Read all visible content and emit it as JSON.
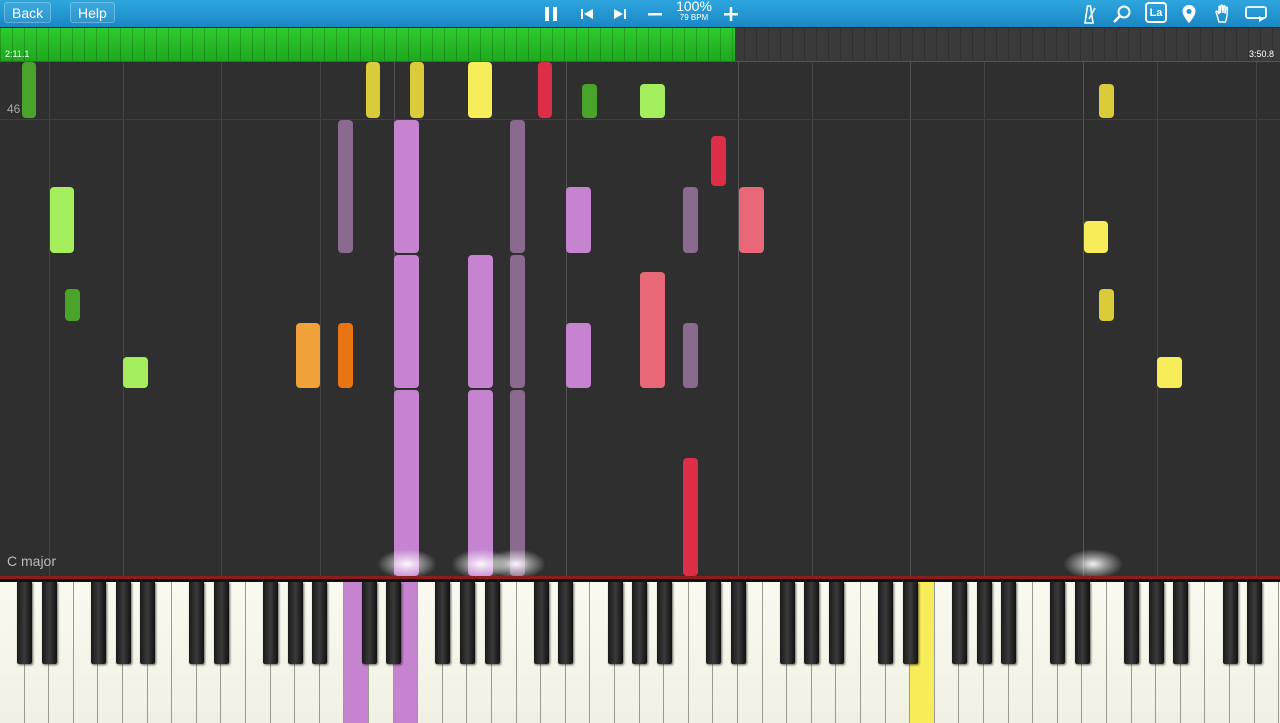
{
  "toolbar": {
    "back_label": "Back",
    "help_label": "Help",
    "zoom": "100%",
    "tempo": "79 BPM",
    "key_notation_label": "La"
  },
  "timeline": {
    "current_time": "2:11.1",
    "total_time": "3:50.8",
    "progress_fraction": 0.574
  },
  "roll": {
    "measure_number": "46",
    "key_signature": "C major"
  },
  "colors": {
    "toolbar": "#1f95d2",
    "progress": "#22b922",
    "background": "#2f2f2f",
    "keyboard_line": "#8a1d1d",
    "lavender": "#c583d0",
    "purple_gray": "#8a6a8e",
    "yellow": "#f7ec5a",
    "dark_yellow": "#d9cb3a",
    "green": "#4aa32a",
    "light_green": "#a4ee5e",
    "orange": "#f2a23a",
    "dark_orange": "#e87512",
    "pink": "#e86877",
    "red": "#dc2e46"
  },
  "pressed_keys": [
    {
      "white_index": 14,
      "color": "lavender"
    },
    {
      "white_index": 16,
      "color": "lavender"
    },
    {
      "white_index": 37,
      "color": "yellow"
    }
  ]
}
